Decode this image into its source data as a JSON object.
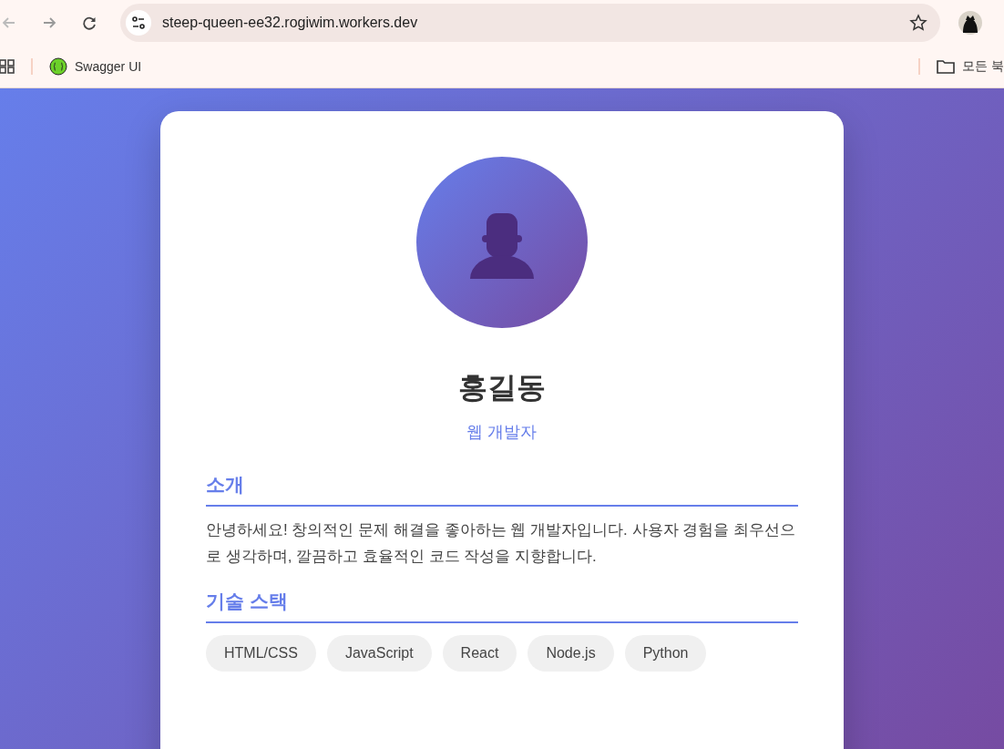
{
  "browser": {
    "url": "steep-queen-ee32.rogiwim.workers.dev",
    "bookmarks": [
      {
        "label": "Swagger UI"
      }
    ],
    "all_bookmarks": "모든 북"
  },
  "profile": {
    "name": "홍길동",
    "role": "웹 개발자"
  },
  "sections": [
    {
      "kind": "text",
      "title": "소개",
      "text": "안녕하세요! 창의적인 문제 해결을 좋아하는 웹 개발자입니다. 사용자 경험을 최우선으로 생각하며, 깔끔하고 효율적인 코드 작성을 지향합니다."
    },
    {
      "kind": "tags",
      "title": "기술 스택",
      "tags": [
        "HTML/CSS",
        "JavaScript",
        "React",
        "Node.js",
        "Python"
      ]
    }
  ]
}
